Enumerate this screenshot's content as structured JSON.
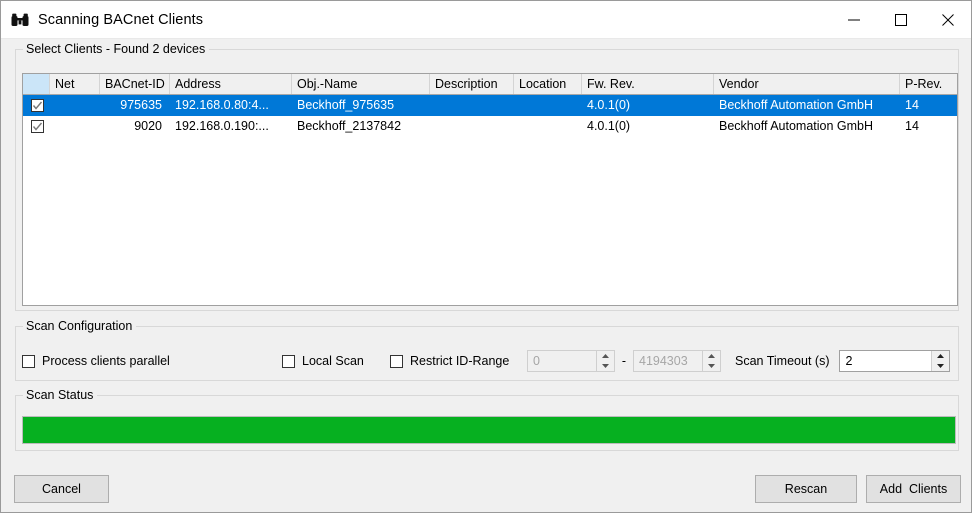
{
  "window": {
    "title": "Scanning BACnet Clients",
    "icon": "binoculars-icon",
    "minimize_label": "—",
    "maximize_label": "□",
    "close_label": "✕"
  },
  "colors": {
    "selection_blue": "#0078d7",
    "progress_green": "#06b020",
    "selectall_header": "#cbe5f8",
    "window_background": "#f0f0f0"
  },
  "clients_group": {
    "legend": "Select Clients - Found 2 devices",
    "columns": [
      {
        "key": "select",
        "label": ""
      },
      {
        "key": "net",
        "label": "Net"
      },
      {
        "key": "bacnet_id",
        "label": "BACnet-ID"
      },
      {
        "key": "address",
        "label": "Address"
      },
      {
        "key": "obj_name",
        "label": "Obj.-Name"
      },
      {
        "key": "description",
        "label": "Description"
      },
      {
        "key": "location",
        "label": "Location"
      },
      {
        "key": "fw_rev",
        "label": "Fw. Rev."
      },
      {
        "key": "vendor",
        "label": "Vendor"
      },
      {
        "key": "p_rev",
        "label": "P-Rev."
      }
    ],
    "rows": [
      {
        "checked": true,
        "selected": true,
        "net": "",
        "bacnet_id": "975635",
        "address": "192.168.0.80:4...",
        "obj_name": "Beckhoff_975635",
        "description": "",
        "location": "",
        "fw_rev": "4.0.1(0)",
        "vendor": "Beckhoff Automation GmbH",
        "p_rev": "14"
      },
      {
        "checked": true,
        "selected": false,
        "net": "",
        "bacnet_id": "9020",
        "address": "192.168.0.190:...",
        "obj_name": "Beckhoff_2137842",
        "description": "",
        "location": "",
        "fw_rev": "4.0.1(0)",
        "vendor": "Beckhoff Automation GmbH",
        "p_rev": "14"
      }
    ]
  },
  "scan_configuration": {
    "legend": "Scan Configuration",
    "process_parallel": {
      "label": "Process clients parallel",
      "checked": false
    },
    "local_scan": {
      "label": "Local Scan",
      "checked": false
    },
    "restrict_id_range": {
      "label": "Restrict ID-Range",
      "checked": false
    },
    "id_range_from": {
      "value": "0",
      "enabled": false
    },
    "id_range_separator": "-",
    "id_range_to": {
      "value": "4194303",
      "enabled": false
    },
    "scan_timeout": {
      "label": "Scan Timeout (s)",
      "value": "2",
      "enabled": true
    }
  },
  "scan_status": {
    "legend": "Scan Status",
    "progress_percent": 100
  },
  "footer": {
    "cancel_label": "Cancel",
    "rescan_label": "Rescan",
    "add_clients_label": "Add  Clients"
  }
}
